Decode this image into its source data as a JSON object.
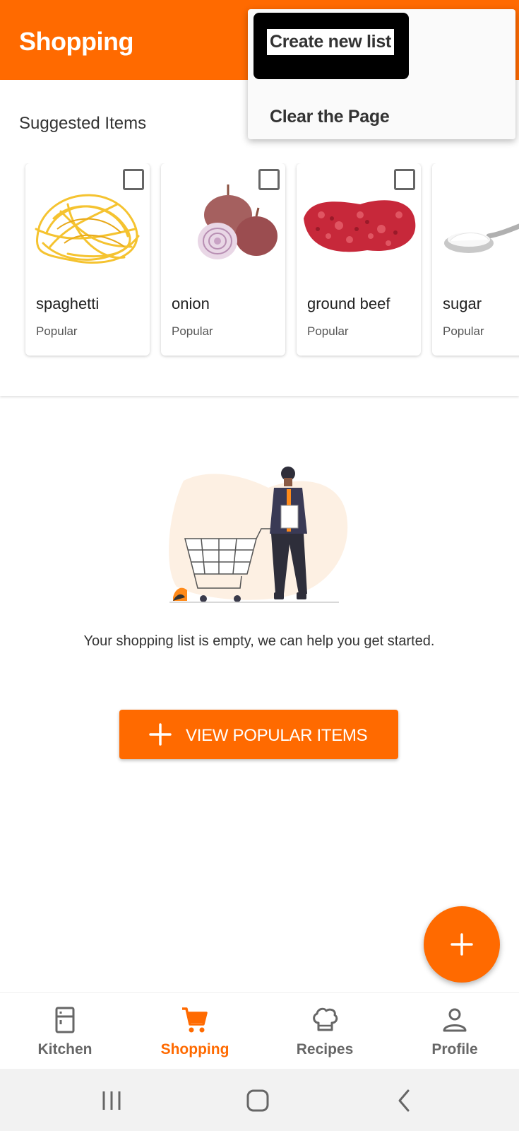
{
  "header": {
    "title": "Shopping",
    "accent_color": "#ff6a00"
  },
  "overflow_menu": {
    "items": [
      {
        "label": "Create new list"
      },
      {
        "label": "Clear the Page"
      }
    ]
  },
  "suggested": {
    "title": "Suggested Items",
    "items": [
      {
        "name": "spaghetti",
        "tag": "Popular",
        "icon": "spaghetti-image"
      },
      {
        "name": "onion",
        "tag": "Popular",
        "icon": "onion-image"
      },
      {
        "name": "ground beef",
        "tag": "Popular",
        "icon": "ground-beef-image"
      },
      {
        "name": "sugar",
        "tag": "Popular",
        "icon": "sugar-spoon-image"
      }
    ]
  },
  "empty_state": {
    "message": "Your shopping list is empty, we can help you get started.",
    "button_label": "VIEW POPULAR ITEMS"
  },
  "bottom_nav": {
    "items": [
      {
        "label": "Kitchen",
        "icon": "fridge-icon"
      },
      {
        "label": "Shopping",
        "icon": "cart-icon",
        "active": true
      },
      {
        "label": "Recipes",
        "icon": "chef-hat-icon"
      },
      {
        "label": "Profile",
        "icon": "person-icon"
      }
    ]
  },
  "system_nav": {
    "buttons": [
      "recent-apps-icon",
      "home-icon",
      "back-icon"
    ]
  }
}
